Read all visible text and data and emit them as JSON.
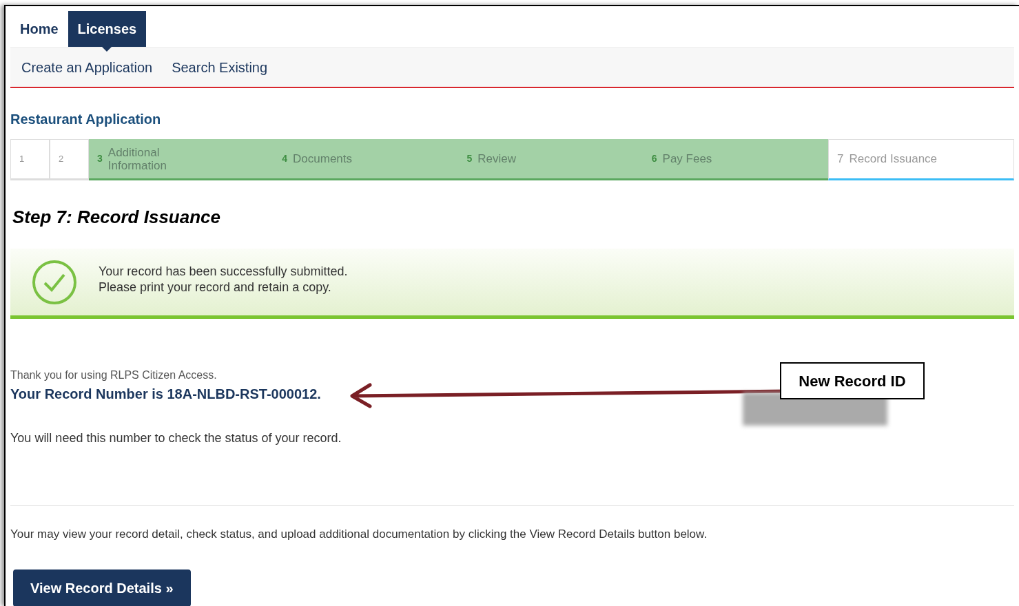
{
  "tabs": [
    {
      "label": "Home",
      "selected": false
    },
    {
      "label": "Licenses",
      "selected": true
    }
  ],
  "subnav": [
    "Create an Application",
    "Search Existing"
  ],
  "page_title": "Restaurant Application",
  "steps": [
    {
      "number": "1",
      "completed": false,
      "selected": false
    },
    {
      "number": "2",
      "completed": false,
      "selected": false
    },
    {
      "number": "3",
      "label": "Additional Information",
      "completed": true,
      "selected": false
    },
    {
      "number": "4",
      "label": "Documents",
      "completed": true,
      "selected": false
    },
    {
      "number": "5",
      "label": "Review",
      "completed": true,
      "selected": false
    },
    {
      "number": "6",
      "label": "Pay Fees",
      "completed": true,
      "selected": false
    },
    {
      "number": "7",
      "label": "Record Issuance",
      "completed": false,
      "selected": true
    }
  ],
  "step_heading": "Step 7: Record Issuance",
  "success_message": [
    "Your record has been successfully submitted.",
    "Please print your record and retain a copy."
  ],
  "thanks_text": "Thank you for using RLPS Citizen Access.",
  "record_number_text": "Your Record Number is 18A-NLBD-RST-000012.",
  "need_number_text": "You will need this number to check the status of your record.",
  "view_details_text": "Your may view your record detail, check status, and upload additional documentation by clicking the View Record Details button below.",
  "view_details_button": "View Record Details »",
  "annotation": {
    "label": "New Record ID"
  }
}
